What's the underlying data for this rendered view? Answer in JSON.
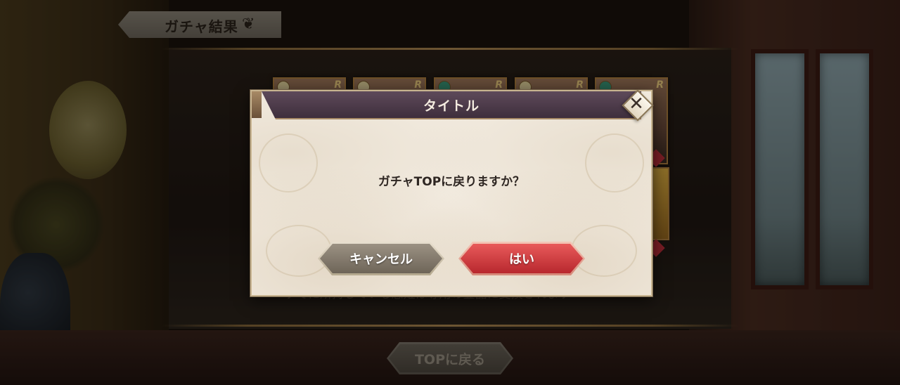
{
  "header": {
    "title": "ガチャ結果"
  },
  "result_cards": [
    {
      "rank": "R",
      "badge": "gold"
    },
    {
      "rank": "R",
      "badge": "gold"
    },
    {
      "rank": "R",
      "badge": "green"
    },
    {
      "rank": "R",
      "badge": "gold"
    },
    {
      "rank": "R",
      "badge": "green"
    }
  ],
  "background_note": "すでに所持している態姫は専用の霊晶に変換されます",
  "bottom": {
    "top_button_label": "TOPに戻る"
  },
  "dialog": {
    "title": "タイトル",
    "close_label": "✕",
    "message": "ガチャTOPに戻りますか？",
    "cancel_label": "キャンセル",
    "confirm_label": "はい"
  },
  "colors": {
    "dialog_bg": "#f3ece1",
    "title_bar": "#4e3c4c",
    "confirm_button": "#d8404a",
    "cancel_button": "#857c6f"
  }
}
